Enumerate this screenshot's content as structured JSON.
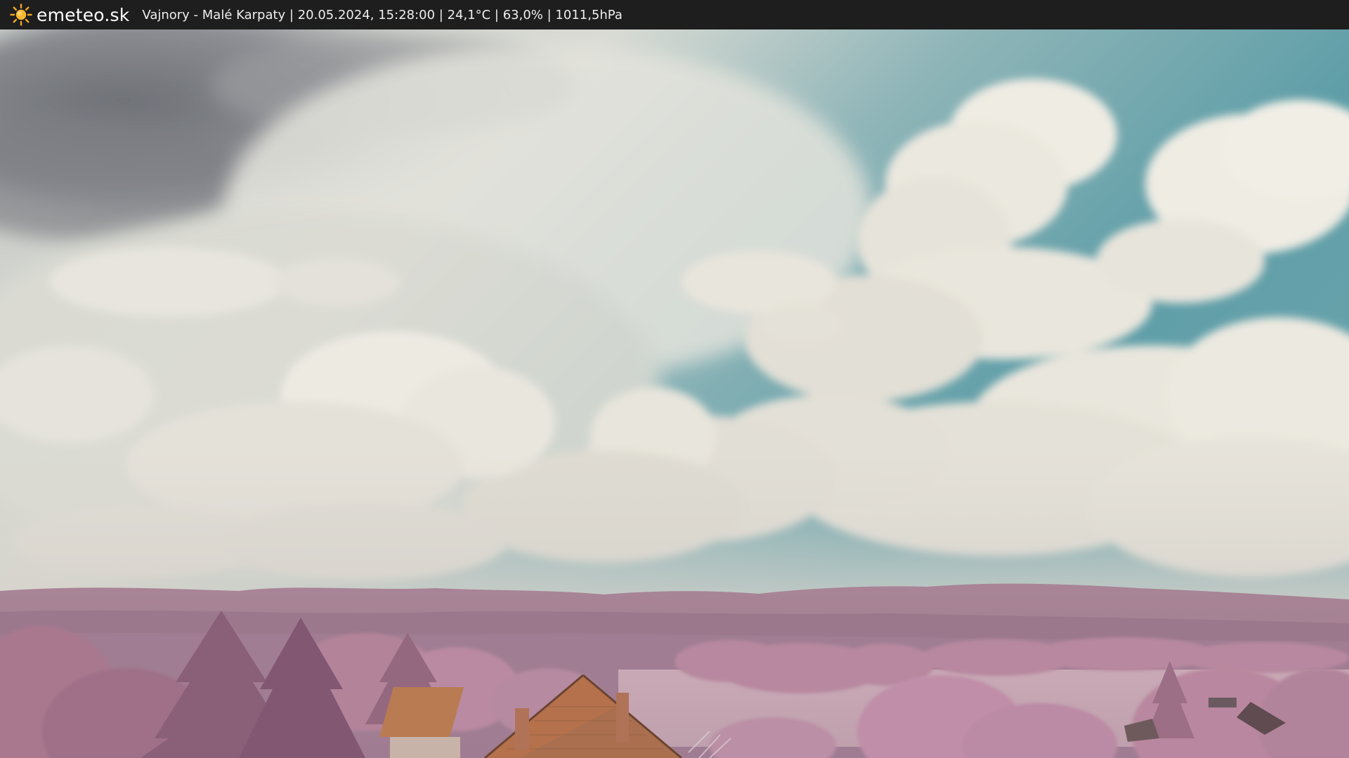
{
  "header": {
    "brand": "emeteo.sk",
    "logo_icon": "sun-icon",
    "caption": "Vajnory - Malé Karpaty | 20.05.2024, 15:28:00 | 24,1°C | 63,0% | 1011,5hPa"
  },
  "colors": {
    "bar": "#1e1e1e",
    "sun": "#f5a623",
    "sky_blue": "#5f9ea8",
    "cloud": "#ece9df",
    "foliage_infrared": "#b98aa8",
    "roof": "#b5714a"
  }
}
